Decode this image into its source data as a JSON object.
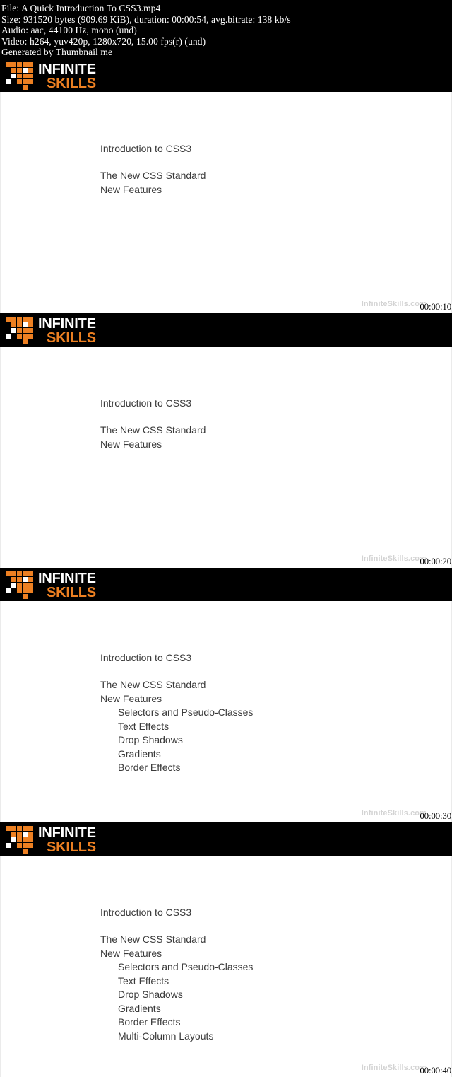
{
  "info_header": {
    "lines": [
      "File: A Quick Introduction To CSS3.mp4",
      "Size: 931520 bytes (909.69 KiB), duration: 00:00:54, avg.bitrate: 138 kb/s",
      "Audio: aac, 44100 Hz, mono (und)",
      "Video: h264, yuv420p, 1280x720, 15.00 fps(r) (und)",
      "Generated by Thumbnail me"
    ],
    "file_name": "File: A Quick Introduction To CSS3.mp4",
    "size_line": "Size: 931520 bytes (909.69 KiB), duration: 00:00:54, avg.bitrate: 138 kb/s",
    "audio_line": "Audio: aac, 44100 Hz, mono (und)",
    "video_line": "Video: h264, yuv420p, 1280x720, 15.00 fps(r) (und)",
    "generator_line": "Generated by Thumbnail me"
  },
  "brand": {
    "word_top": "INFINITE",
    "word_bottom": "SKILLS",
    "orange": "#ED8022",
    "white": "#FFFFFF",
    "banner_bg": "#000000"
  },
  "watermark_text": "InfiniteSkills.com",
  "thumbnails": [
    {
      "timestamp": "00:00:10",
      "title": "Introduction to CSS3",
      "lines": [
        "The New CSS Standard",
        "New Features"
      ],
      "sublines": []
    },
    {
      "timestamp": "00:00:20",
      "title": "Introduction to CSS3",
      "lines": [
        "The New CSS Standard",
        "New Features"
      ],
      "sublines": []
    },
    {
      "timestamp": "00:00:30",
      "title": "Introduction to CSS3",
      "lines": [
        "The New CSS Standard",
        "New Features"
      ],
      "sublines": [
        "Selectors and Pseudo-Classes",
        "Text Effects",
        "Drop Shadows",
        "Gradients",
        "Border Effects"
      ]
    },
    {
      "timestamp": "00:00:40",
      "title": "Introduction to CSS3",
      "lines": [
        "The New CSS Standard",
        "New Features"
      ],
      "sublines": [
        "Selectors and Pseudo-Classes",
        "Text Effects",
        "Drop Shadows",
        "Gradients",
        "Border Effects",
        "Multi-Column Layouts"
      ]
    }
  ]
}
